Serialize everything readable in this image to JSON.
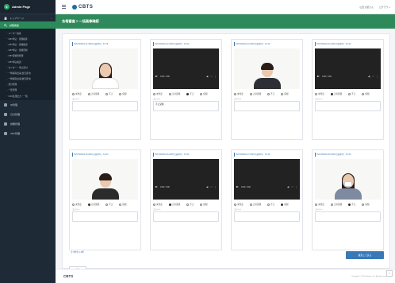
{
  "brand": {
    "title": "Admin Page"
  },
  "topbar": {
    "logo": "CBTS",
    "user": "山田 太郎さん",
    "logout": "ログアウト"
  },
  "sidebar": {
    "items": [
      {
        "label": "トップページ",
        "icon": "home-icon"
      },
      {
        "label": "試験関連",
        "icon": "search-icon",
        "active": true
      }
    ],
    "subitems": [
      "ユーザー検索",
      "CBT申込・受験検索",
      "CBT申込・受験確認",
      "CBT申込・受験登録",
      "CBT受験者管理",
      "CBT申込確認",
      "センター・申込受付",
      "一時保存出来(当日受付)",
      "一時保存出来(後日受付)",
      "受付管理",
      "一覧管理",
      "CSV結果出力・一覧"
    ],
    "sections": [
      "ID管理",
      "日付管理",
      "試験管理",
      "CBT管理"
    ]
  },
  "title": "合格審査 > 一括画像確認",
  "cards": [
    {
      "header": "TEST000001-01 000%合格率(5)：3X-78",
      "media": "photo",
      "person": "woman",
      "time": "",
      "radios": [
        "未判定",
        "正常受験",
        "不正"
      ],
      "radios2": [
        "保留"
      ],
      "checked": "",
      "comment_label": "コメント",
      "comment": ""
    },
    {
      "header": "TEST000001-02 000%合格率(5)：XX-00",
      "media": "video",
      "time": "0:00 / 0:00",
      "radios": [
        "未判定",
        "正常受験",
        "不正"
      ],
      "radios2": [
        "保留"
      ],
      "checked": "不正",
      "comment_label": "コメント",
      "comment": "不正受験"
    },
    {
      "header": "TEST000001-03 000%合格率(5)：XX-00",
      "media": "photo",
      "person": "man-suit",
      "time": "",
      "radios": [
        "未判定",
        "正常受験",
        "不正"
      ],
      "radios2": [
        "保留"
      ],
      "checked": "",
      "comment_label": "コメント",
      "comment": ""
    },
    {
      "header": "TEST000001-04 000%合格率(5)：XX-00",
      "media": "video",
      "time": "0:00 / 0:00",
      "radios": [
        "未判定",
        "正常受験",
        "不正"
      ],
      "radios2": [
        "保留"
      ],
      "checked": "正常受験",
      "comment_label": "コメント",
      "comment": ""
    },
    {
      "header": "TEST000001-05 000%合格率(5)：XX-00",
      "media": "photo",
      "person": "man",
      "time": "",
      "radios": [
        "未判定",
        "正常受験",
        "不正"
      ],
      "radios2": [
        "保留"
      ],
      "checked": "正常受験",
      "comment_label": "コメント",
      "comment": ""
    },
    {
      "header": "TEST000001-06 000%合格率(5)：XX-00",
      "media": "video",
      "time": "0:00 / 0:00",
      "radios": [
        "未判定",
        "正常受験",
        "不正"
      ],
      "radios2": [
        "保留"
      ],
      "checked": "正常受験",
      "comment_label": "コメント",
      "comment": ""
    },
    {
      "header": "TEST000001-07 000%合格率(5)：XX-00",
      "media": "video",
      "time": "0:00 / 0:00",
      "radios": [
        "未判定",
        "正常受験",
        "不正"
      ],
      "radios2": [
        "保留"
      ],
      "checked": "保留",
      "comment_label": "コメント",
      "comment": ""
    },
    {
      "header": "TEST000001-08 000%合格率(5)：XX-00",
      "media": "photo",
      "person": "woman-mask",
      "time": "",
      "radios": [
        "未判定",
        "正常受験",
        "不正"
      ],
      "radios2": [
        "保留"
      ],
      "checked": "不正",
      "comment_label": "コメント",
      "comment": ""
    }
  ],
  "footnote": "全 8件中 1-8件",
  "buttons": {
    "back": "戻る",
    "save": "確定して戻る"
  },
  "footer": {
    "logo": "CBTS",
    "copyright": "Copyright © CBT-Solutions Inc. All rights reserved."
  },
  "colors": {
    "sidebar": "#1e2b37",
    "accent": "#2f8a5b",
    "primary": "#3a79b8"
  }
}
